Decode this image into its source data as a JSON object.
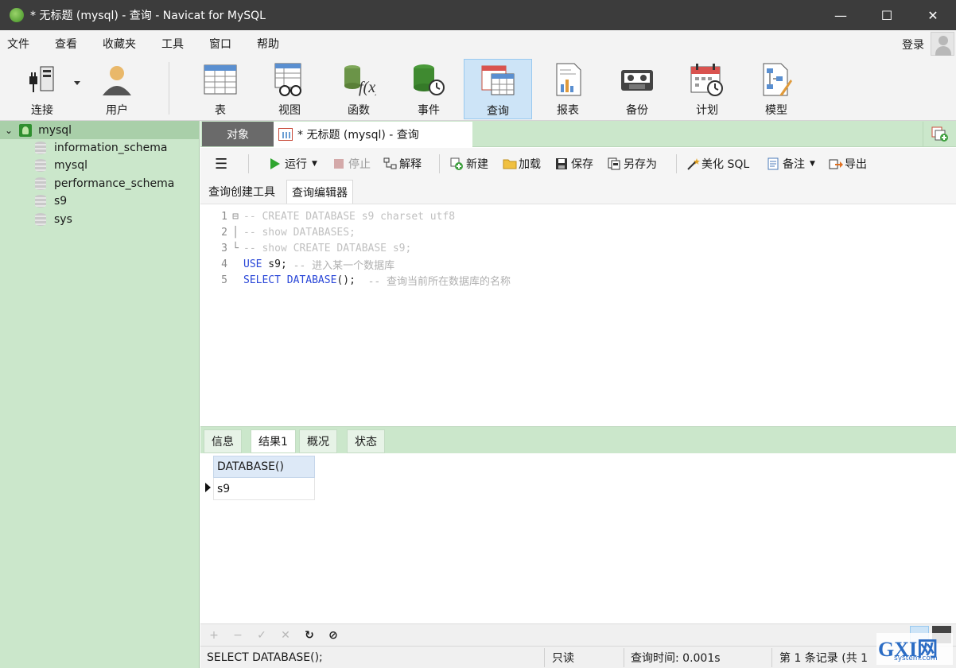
{
  "window": {
    "title": "* 无标题 (mysql) - 查询 - Navicat for MySQL",
    "minimize": "—",
    "maximize": "☐",
    "close": "✕"
  },
  "menu": {
    "items": [
      "文件",
      "查看",
      "收藏夹",
      "工具",
      "窗口",
      "帮助"
    ],
    "login": "登录"
  },
  "ribbon": {
    "buttons": [
      {
        "label": "连接",
        "icon": "plug-icon"
      },
      {
        "label": "用户",
        "icon": "user-icon"
      },
      {
        "label": "表",
        "icon": "table-icon"
      },
      {
        "label": "视图",
        "icon": "view-icon"
      },
      {
        "label": "函数",
        "icon": "function-icon"
      },
      {
        "label": "事件",
        "icon": "event-icon"
      },
      {
        "label": "查询",
        "icon": "query-icon",
        "active": true
      },
      {
        "label": "报表",
        "icon": "report-icon"
      },
      {
        "label": "备份",
        "icon": "backup-icon"
      },
      {
        "label": "计划",
        "icon": "schedule-icon"
      },
      {
        "label": "模型",
        "icon": "model-icon"
      }
    ]
  },
  "sidebar": {
    "root": "mysql",
    "databases": [
      "information_schema",
      "mysql",
      "performance_schema",
      "s9",
      "sys"
    ]
  },
  "tabs": {
    "objects": "对象",
    "query": "* 无标题 (mysql) - 查询"
  },
  "query_toolbar": {
    "menu_icon": "☰",
    "run": "运行",
    "stop": "停止",
    "explain": "解释",
    "new": "新建",
    "load": "加载",
    "save": "保存",
    "save_as": "另存为",
    "beautify": "美化 SQL",
    "comment": "备注",
    "export": "导出"
  },
  "sub_tabs": {
    "builder": "查询创建工具",
    "editor": "查询编辑器"
  },
  "editor": {
    "lines": [
      {
        "num": "1",
        "fold": "⊟",
        "text": "-- CREATE DATABASE s9 charset utf8"
      },
      {
        "num": "2",
        "fold": "│",
        "text": "-- show DATABASES;"
      },
      {
        "num": "3",
        "fold": "└",
        "text": "-- show CREATE DATABASE s9;"
      },
      {
        "num": "4",
        "fold": "",
        "kw": "USE",
        "rest": " s9; ",
        "comment": "-- 进入某一个数据库"
      },
      {
        "num": "5",
        "fold": "",
        "kw": "SELECT",
        "rest2": " ",
        "kw2": "DATABASE",
        "rest": "();  ",
        "comment": "-- 查询当前所在数据库的名称"
      }
    ]
  },
  "result_tabs": [
    "信息",
    "结果1",
    "概况",
    "状态"
  ],
  "result": {
    "columns": [
      "DATABASE()"
    ],
    "rows": [
      [
        "s9"
      ]
    ]
  },
  "grid_toolbar": {
    "add": "+",
    "remove": "−",
    "apply": "✓",
    "cancel": "✕",
    "refresh": "↻",
    "stop": "⊘"
  },
  "status": {
    "sql": "SELECT DATABASE();",
    "mode": "只读",
    "time": "查询时间: 0.001s",
    "records": "第 1 条记录 (共 1"
  },
  "watermark": {
    "logo": "GXI网",
    "domain": "system.com"
  },
  "colors": {
    "titlebar": "#3c3c3c",
    "sidebar": "#cbe7cb",
    "accent": "#cde4f7",
    "keyword": "#2a47d8",
    "comment": "#b0b0b0"
  }
}
